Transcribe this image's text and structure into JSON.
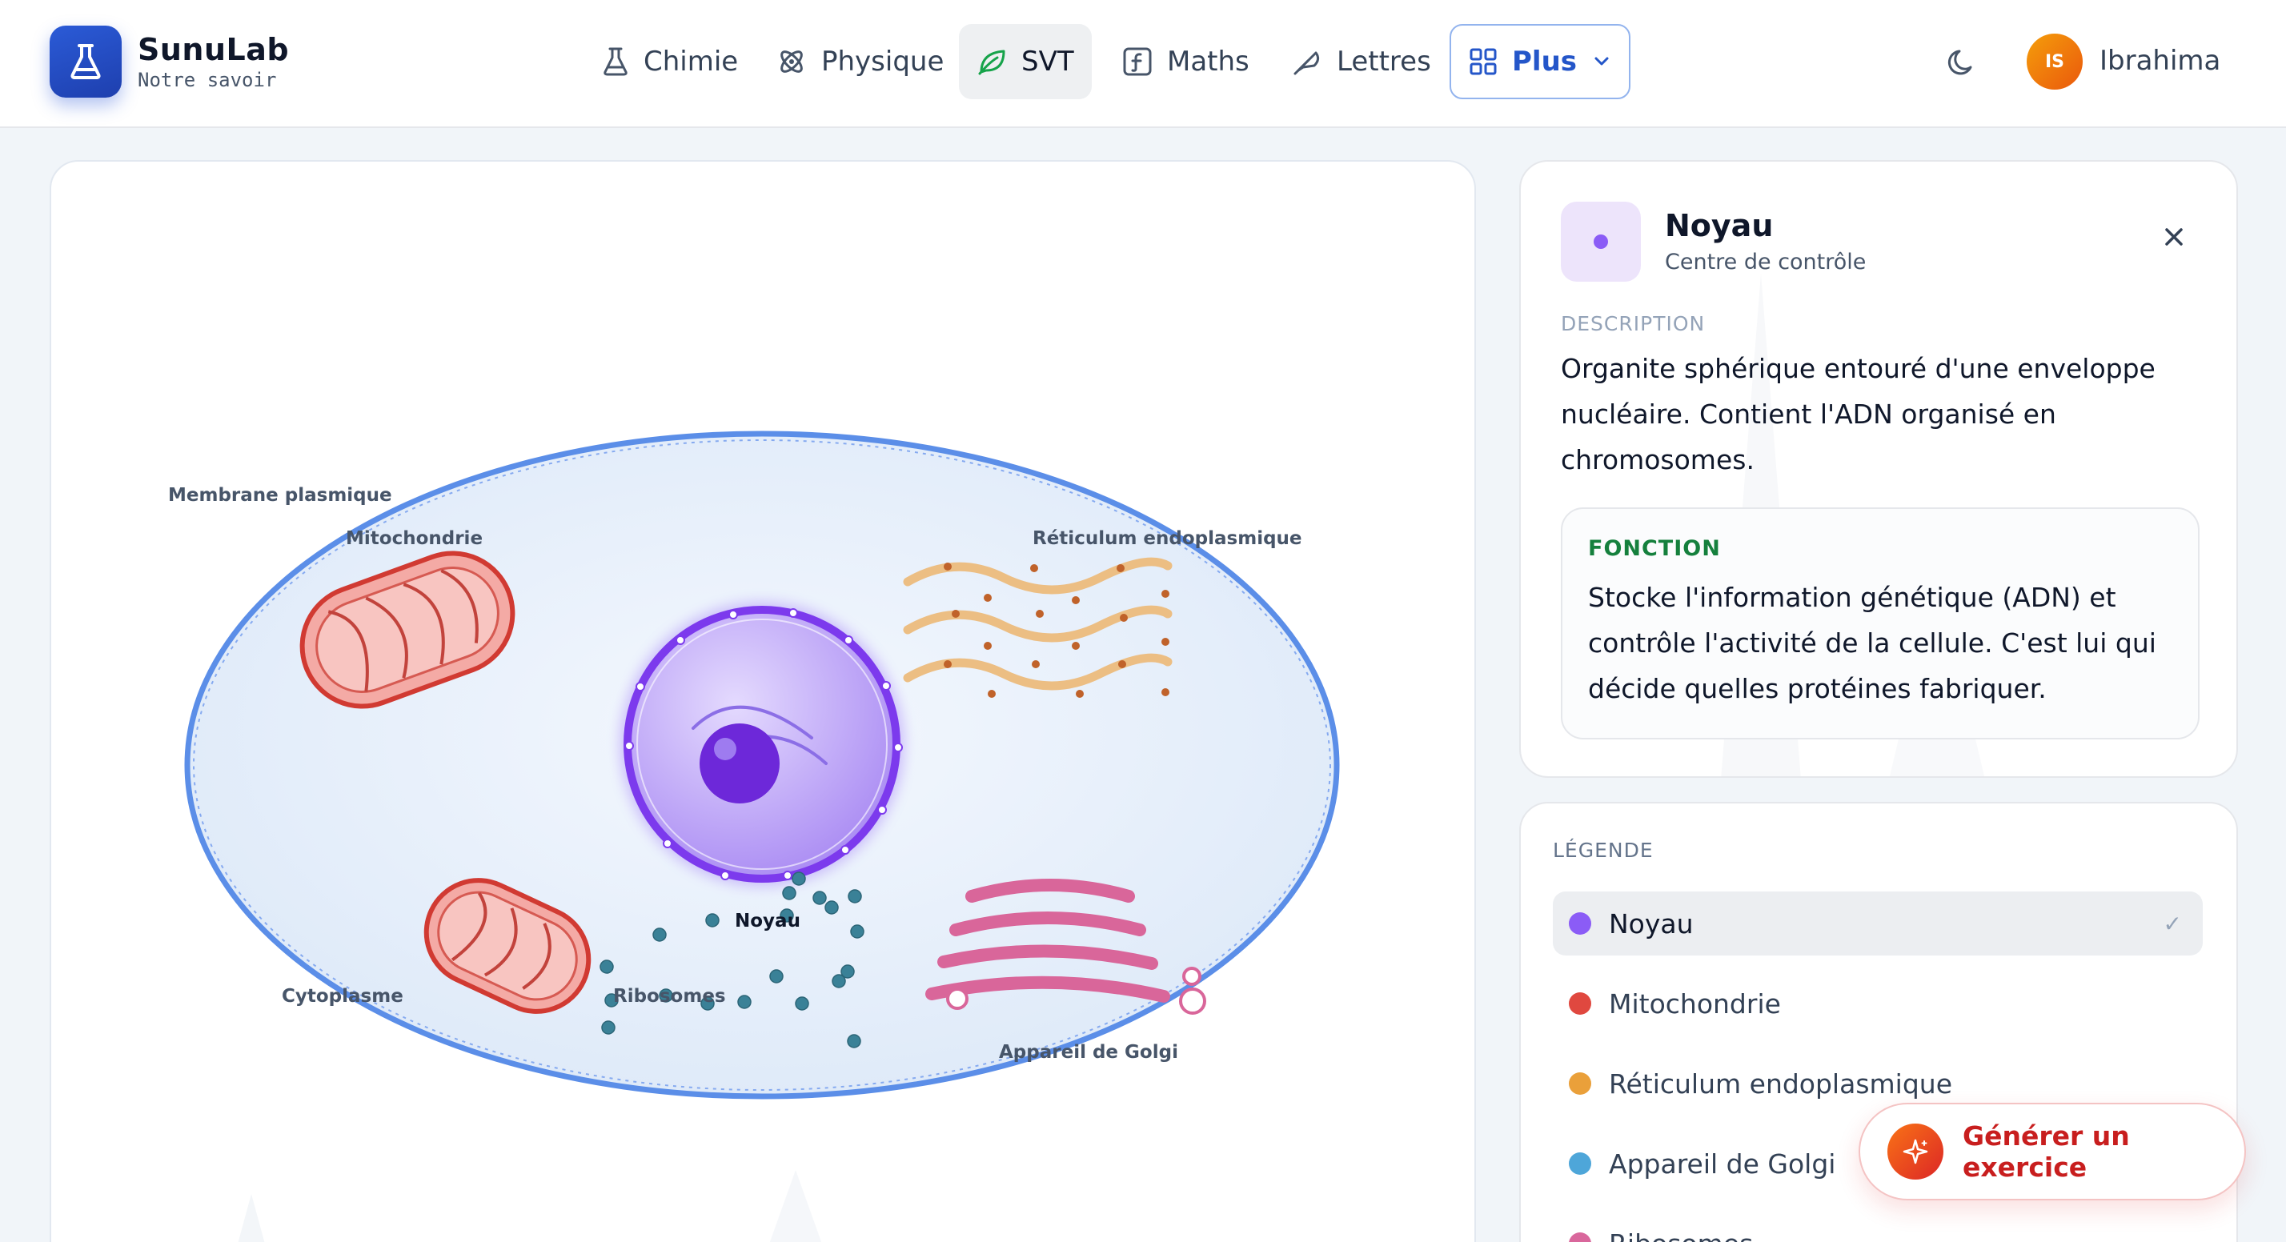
{
  "brand": {
    "name": "SunuLab",
    "tagline": "Notre savoir"
  },
  "nav": {
    "items": [
      {
        "label": "Chimie",
        "icon": "flask-icon"
      },
      {
        "label": "Physique",
        "icon": "atom-icon"
      },
      {
        "label": "SVT",
        "icon": "leaf-icon",
        "active": true
      },
      {
        "label": "Maths",
        "icon": "function-icon"
      },
      {
        "label": "Lettres",
        "icon": "feather-icon"
      }
    ],
    "more_label": "Plus"
  },
  "user": {
    "initials": "IS",
    "name": "Ibrahima"
  },
  "diagram": {
    "labels": {
      "membrane": "Membrane plasmique",
      "mitochondrie": "Mitochondrie",
      "reticulum": "Réticulum endoplasmique",
      "noyau": "Noyau",
      "cytoplasme": "Cytoplasme",
      "ribosomes": "Ribosomes",
      "golgi": "Appareil de Golgi"
    },
    "selected": "Noyau"
  },
  "detail": {
    "title": "Noyau",
    "subtitle": "Centre de contrôle",
    "description_label": "DESCRIPTION",
    "description": "Organite sphérique entouré d'une enveloppe nucléaire. Contient l'ADN organisé en chromosomes.",
    "function_label": "FONCTION",
    "function": "Stocke l'information génétique (ADN) et contrôle l'activité de la cellule. C'est lui qui décide quelles protéines fabriquer."
  },
  "legend": {
    "title": "LÉGENDE",
    "items": [
      {
        "label": "Noyau",
        "color": "#8b5cf6",
        "active": true,
        "check": "✓"
      },
      {
        "label": "Mitochondrie",
        "color": "#e0483f"
      },
      {
        "label": "Réticulum endoplasmique",
        "color": "#eaa03a"
      },
      {
        "label": "Appareil de Golgi",
        "color": "#4ea6d9"
      },
      {
        "label": "Ribosomes",
        "color": "#d9679c"
      }
    ]
  },
  "generate_button": {
    "label": "Générer un exercice"
  },
  "colors": {
    "accent": "#2456c9",
    "nucleus": "#7c3aed",
    "mitochondria": "#d63c33",
    "reticulum": "#eab06a",
    "golgi": "#d9669a",
    "membrane": "#4e86e5",
    "ribosome": "#3a8197"
  }
}
